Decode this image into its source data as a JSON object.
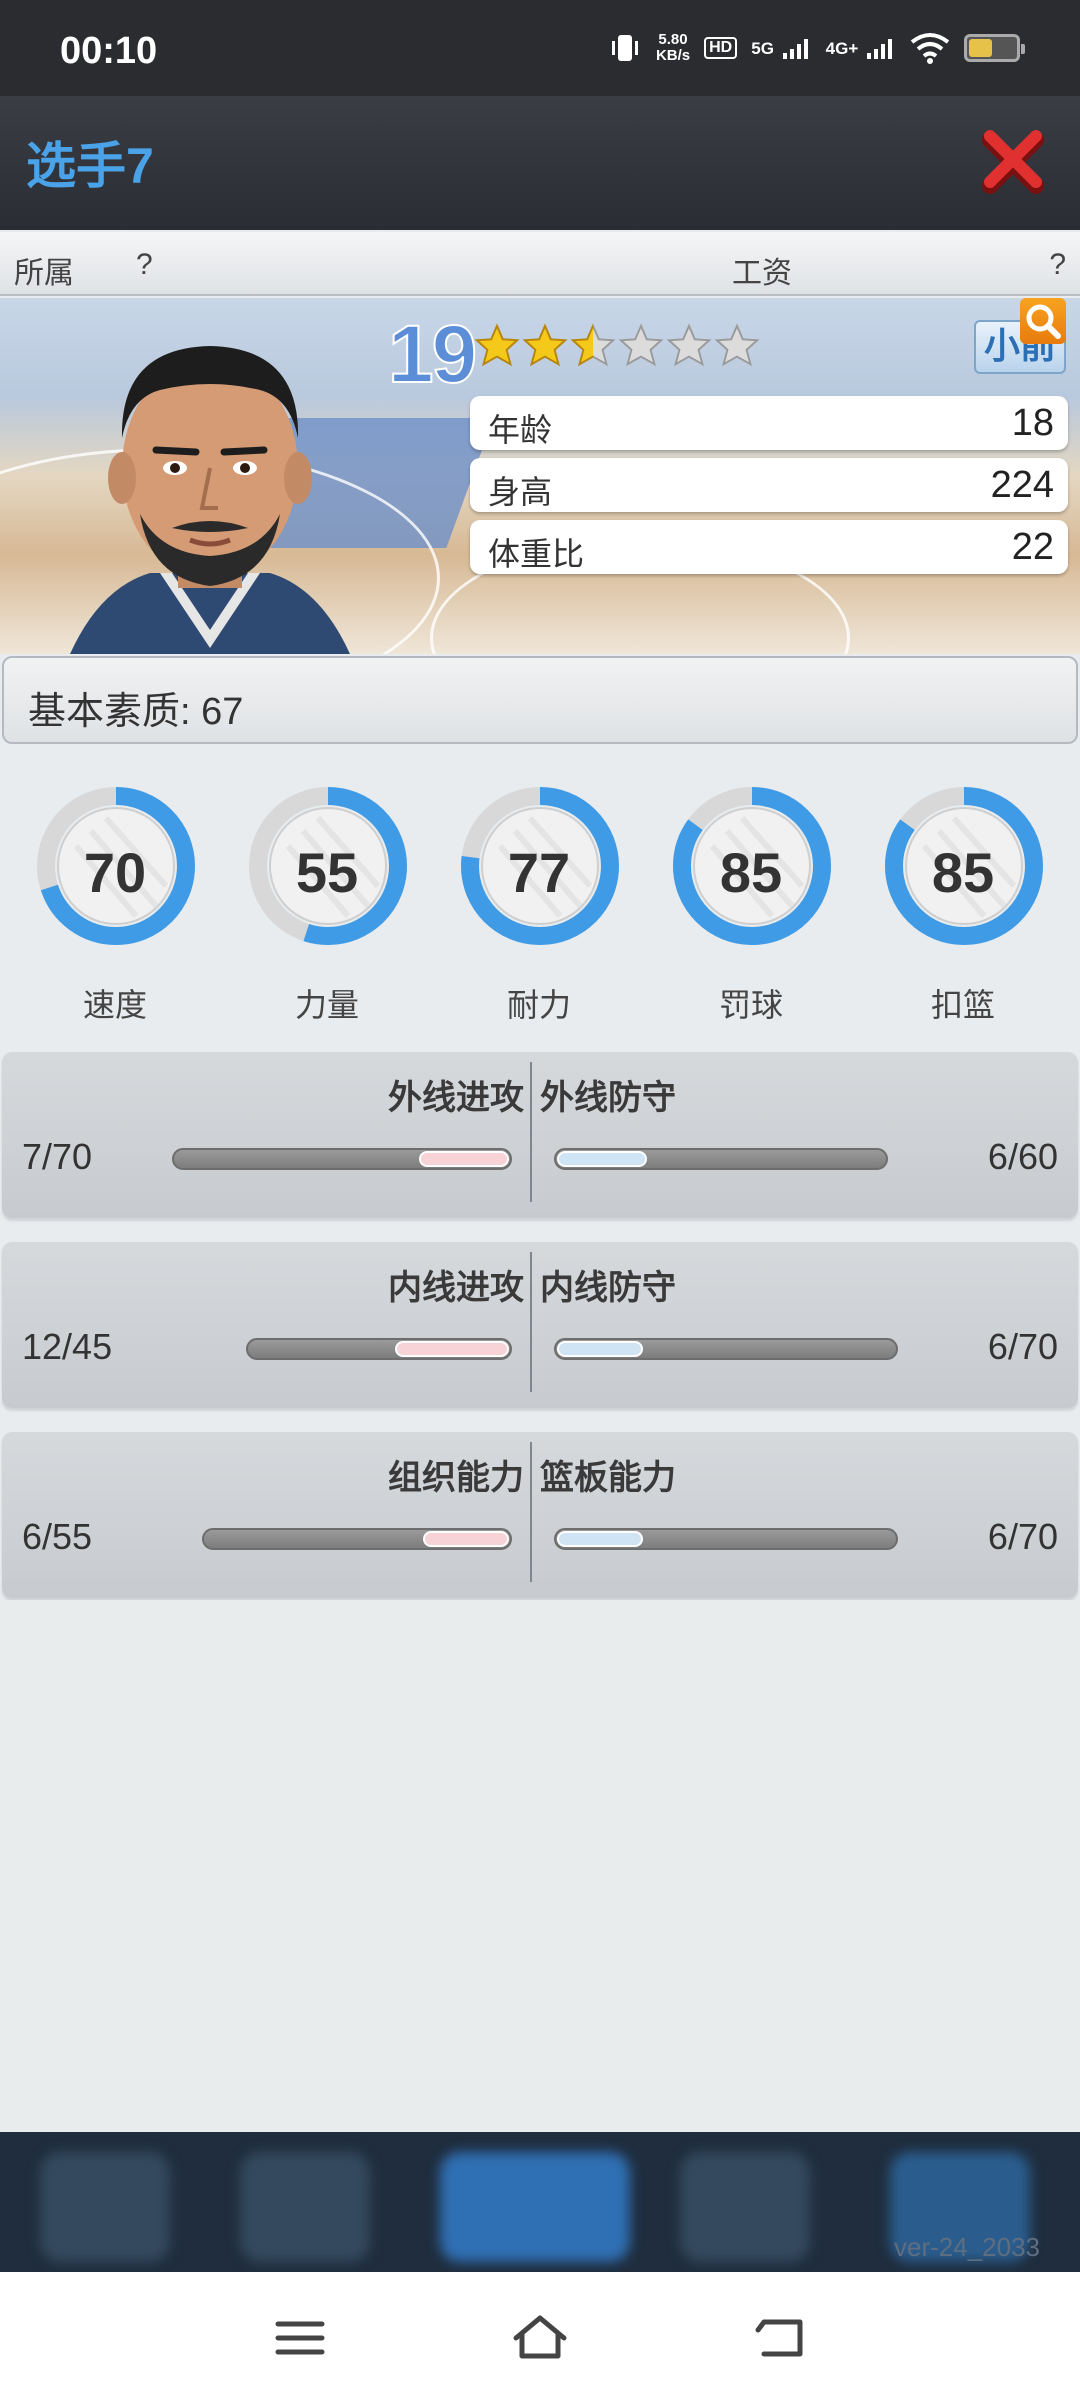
{
  "status_bar": {
    "time": "00:10",
    "net_speed_top": "5.80",
    "net_speed_unit": "KB/s",
    "hd": "HD",
    "sim1": "5G",
    "sim2": "4G+"
  },
  "header": {
    "title": "选手7"
  },
  "info_bar": {
    "affiliation_label": "所属",
    "affiliation_value": "?",
    "salary_label": "工资",
    "salary_value": "?"
  },
  "player": {
    "level": "19",
    "stars_filled": 2.5,
    "stars_total": 6,
    "position": "小前",
    "stats": [
      {
        "label": "年龄",
        "value": "18"
      },
      {
        "label": "身高",
        "value": "224"
      },
      {
        "label": "体重比",
        "value": "22"
      }
    ]
  },
  "basic": {
    "label": "基本素质: 67"
  },
  "gauges": [
    {
      "label": "速度",
      "value": "70",
      "level": 0.7
    },
    {
      "label": "力量",
      "value": "55",
      "level": 0.55
    },
    {
      "label": "耐力",
      "value": "77",
      "level": 0.77
    },
    {
      "label": "罚球",
      "value": "85",
      "level": 0.85
    },
    {
      "label": "扣篮",
      "value": "85",
      "level": 0.85
    }
  ],
  "skills": [
    {
      "left_name": "外线进攻",
      "left_value": "7/70",
      "right_name": "外线防守",
      "right_value": "6/60"
    },
    {
      "left_name": "内线进攻",
      "left_value": "12/45",
      "right_name": "内线防守",
      "right_value": "6/70"
    },
    {
      "left_name": "组织能力",
      "left_value": "6/55",
      "right_name": "篮板能力",
      "right_value": "6/70"
    }
  ],
  "footer": {
    "version": "ver-24_2033"
  },
  "colors": {
    "accent": "#4aa3e8",
    "close": "#d42a2a",
    "gauge_fill": "#3f9be6",
    "gauge_track": "#d8d8d8"
  }
}
